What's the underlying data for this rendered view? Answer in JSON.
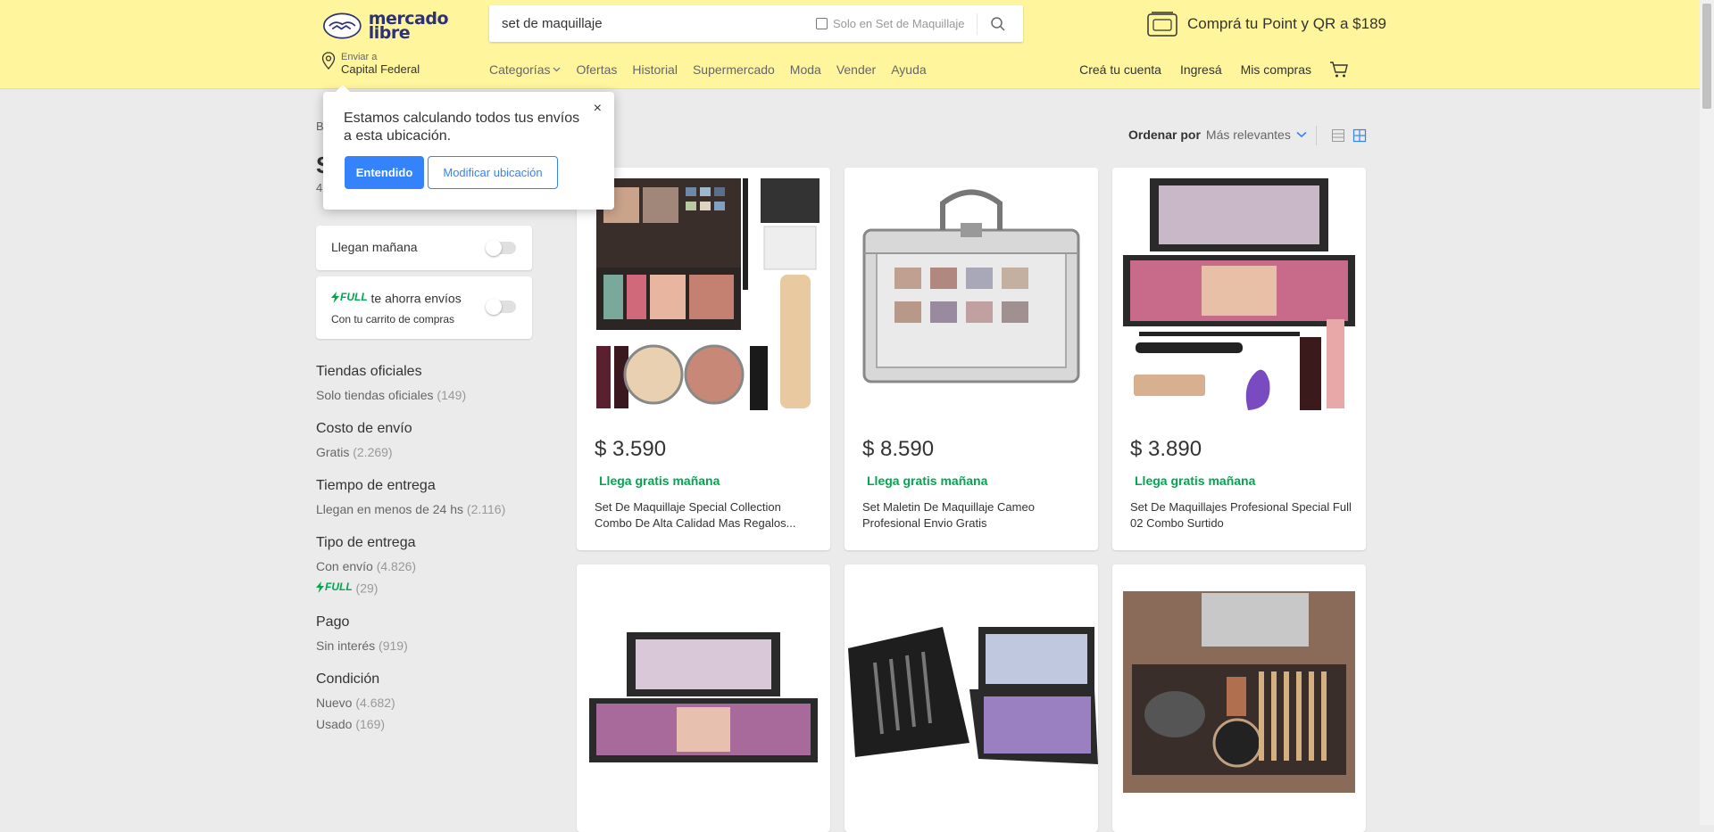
{
  "header": {
    "logo_line1": "mercado",
    "logo_line2": "libre",
    "search_value": "set de maquillaje",
    "search_filter_label": "Solo en Set de Maquillaje",
    "promo_text": "Comprá tu Point y QR a $189",
    "location_small": "Enviar a",
    "location_big": "Capital Federal",
    "nav": [
      "Categorías",
      "Ofertas",
      "Historial",
      "Supermercado",
      "Moda",
      "Vender",
      "Ayuda"
    ],
    "user_nav": [
      "Creá tu cuenta",
      "Ingresá",
      "Mis compras"
    ]
  },
  "page": {
    "breadcrumb": "B",
    "title": "S",
    "results": "4"
  },
  "popup": {
    "text": "Estamos calculando todos tus envíos a esta ubicación.",
    "close": "×",
    "primary": "Entendido",
    "secondary": "Modificar ubicación"
  },
  "toggles": {
    "tomorrow": "Llegan mañana",
    "full_badge": "FULL",
    "full_text": "te ahorra envíos",
    "full_sub": "Con tu carrito de compras"
  },
  "filters": [
    {
      "title": "Tiendas oficiales",
      "items": [
        {
          "label": "Solo tiendas oficiales",
          "count": "(149)"
        }
      ]
    },
    {
      "title": "Costo de envío",
      "items": [
        {
          "label": "Gratis",
          "count": "(2.269)"
        }
      ]
    },
    {
      "title": "Tiempo de entrega",
      "items": [
        {
          "label": "Llegan en menos de 24 hs",
          "count": "(2.116)"
        }
      ]
    },
    {
      "title": "Tipo de entrega",
      "items": [
        {
          "label": "Con envío",
          "count": "(4.826)"
        },
        {
          "label": "FULL",
          "count": "(29)"
        }
      ]
    },
    {
      "title": "Pago",
      "items": [
        {
          "label": "Sin interés",
          "count": "(919)"
        }
      ]
    },
    {
      "title": "Condición",
      "items": [
        {
          "label": "Nuevo",
          "count": "(4.682)"
        },
        {
          "label": "Usado",
          "count": "(169)"
        }
      ]
    }
  ],
  "sort": {
    "label": "Ordenar por",
    "value": "Más relevantes"
  },
  "products": [
    {
      "price": "$ 3.590",
      "shipping": "Llega gratis mañana",
      "title": "Set De Maquillaje Special Collection Combo De Alta Calidad Mas Regalos..."
    },
    {
      "price": "$ 8.590",
      "shipping": "Llega gratis mañana",
      "title": "Set Maletin De Maquillaje Cameo Profesional Envio Gratis"
    },
    {
      "price": "$ 3.890",
      "shipping": "Llega gratis mañana",
      "title": "Set De Maquillajes Profesional Special Full 02 Combo Surtido"
    }
  ],
  "colors": {
    "header_bg": "#fff59d",
    "accent": "#3483fa",
    "green": "#00a650"
  }
}
